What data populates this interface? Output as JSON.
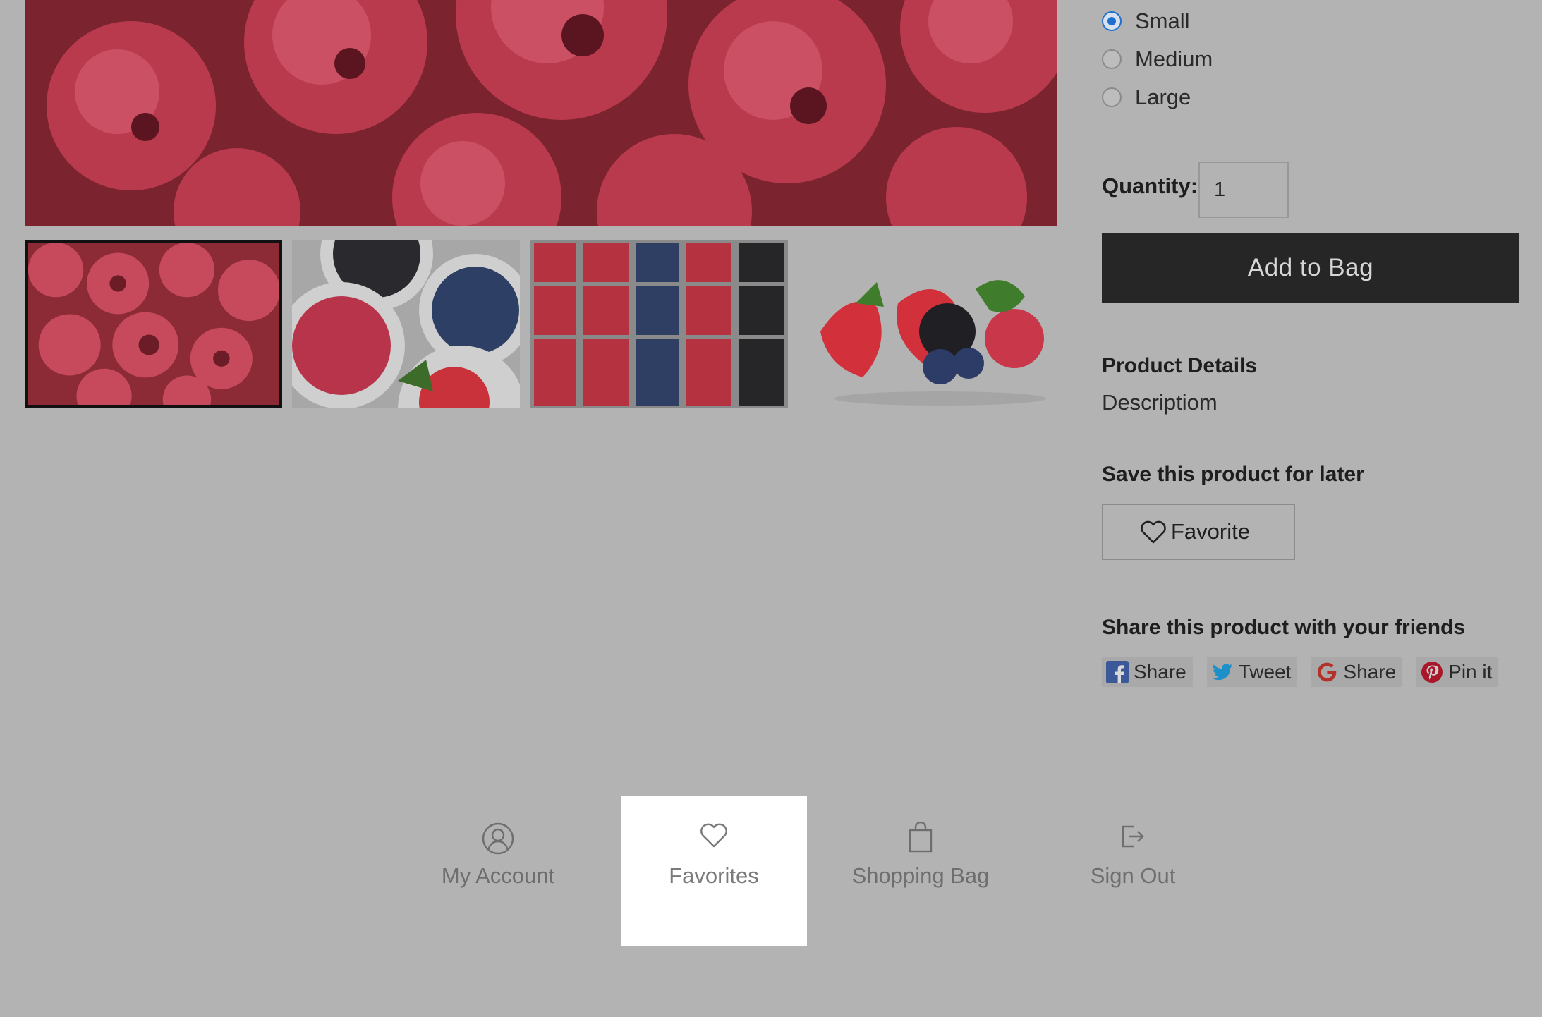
{
  "product": {
    "size_options": [
      {
        "label": "Small",
        "selected": true
      },
      {
        "label": "Medium",
        "selected": false
      },
      {
        "label": "Large",
        "selected": false
      }
    ],
    "quantity_label": "Quantity:",
    "quantity_value": "1",
    "add_to_bag_label": "Add to Bag",
    "details_heading": "Product Details",
    "description": "Descriptiom",
    "save_heading": "Save this product for later",
    "favorite_label": "Favorite",
    "share_heading": "Share this product with your friends",
    "share_buttons": [
      {
        "label": "Share",
        "icon": "facebook-icon",
        "color": "#3b5998"
      },
      {
        "label": "Tweet",
        "icon": "twitter-icon",
        "color": "#1da1f2"
      },
      {
        "label": "Share",
        "icon": "google-icon",
        "color": "#c0392b"
      },
      {
        "label": "Pin it",
        "icon": "pinterest-icon",
        "color": "#bd081c"
      }
    ]
  },
  "gallery": {
    "main_image": "raspberries-photo",
    "thumbnails": [
      {
        "subject": "raspberries-photo",
        "selected": true
      },
      {
        "subject": "berry-bowls-photo",
        "selected": false
      },
      {
        "subject": "berry-punnets-photo",
        "selected": false
      },
      {
        "subject": "mixed-berries-photo",
        "selected": false
      }
    ]
  },
  "bottom_nav": {
    "items": [
      {
        "label": "My Account",
        "icon": "user-circle-icon",
        "active": false
      },
      {
        "label": "Favorites",
        "icon": "heart-icon",
        "active": true
      },
      {
        "label": "Shopping Bag",
        "icon": "shopping-bag-icon",
        "active": false
      },
      {
        "label": "Sign Out",
        "icon": "sign-out-icon",
        "active": false
      }
    ]
  },
  "colors": {
    "overlay_background": "#b3b3b3",
    "primary_button": "#262626",
    "radio_selected": "#1f6fd0",
    "active_nav_background": "#ffffff"
  }
}
